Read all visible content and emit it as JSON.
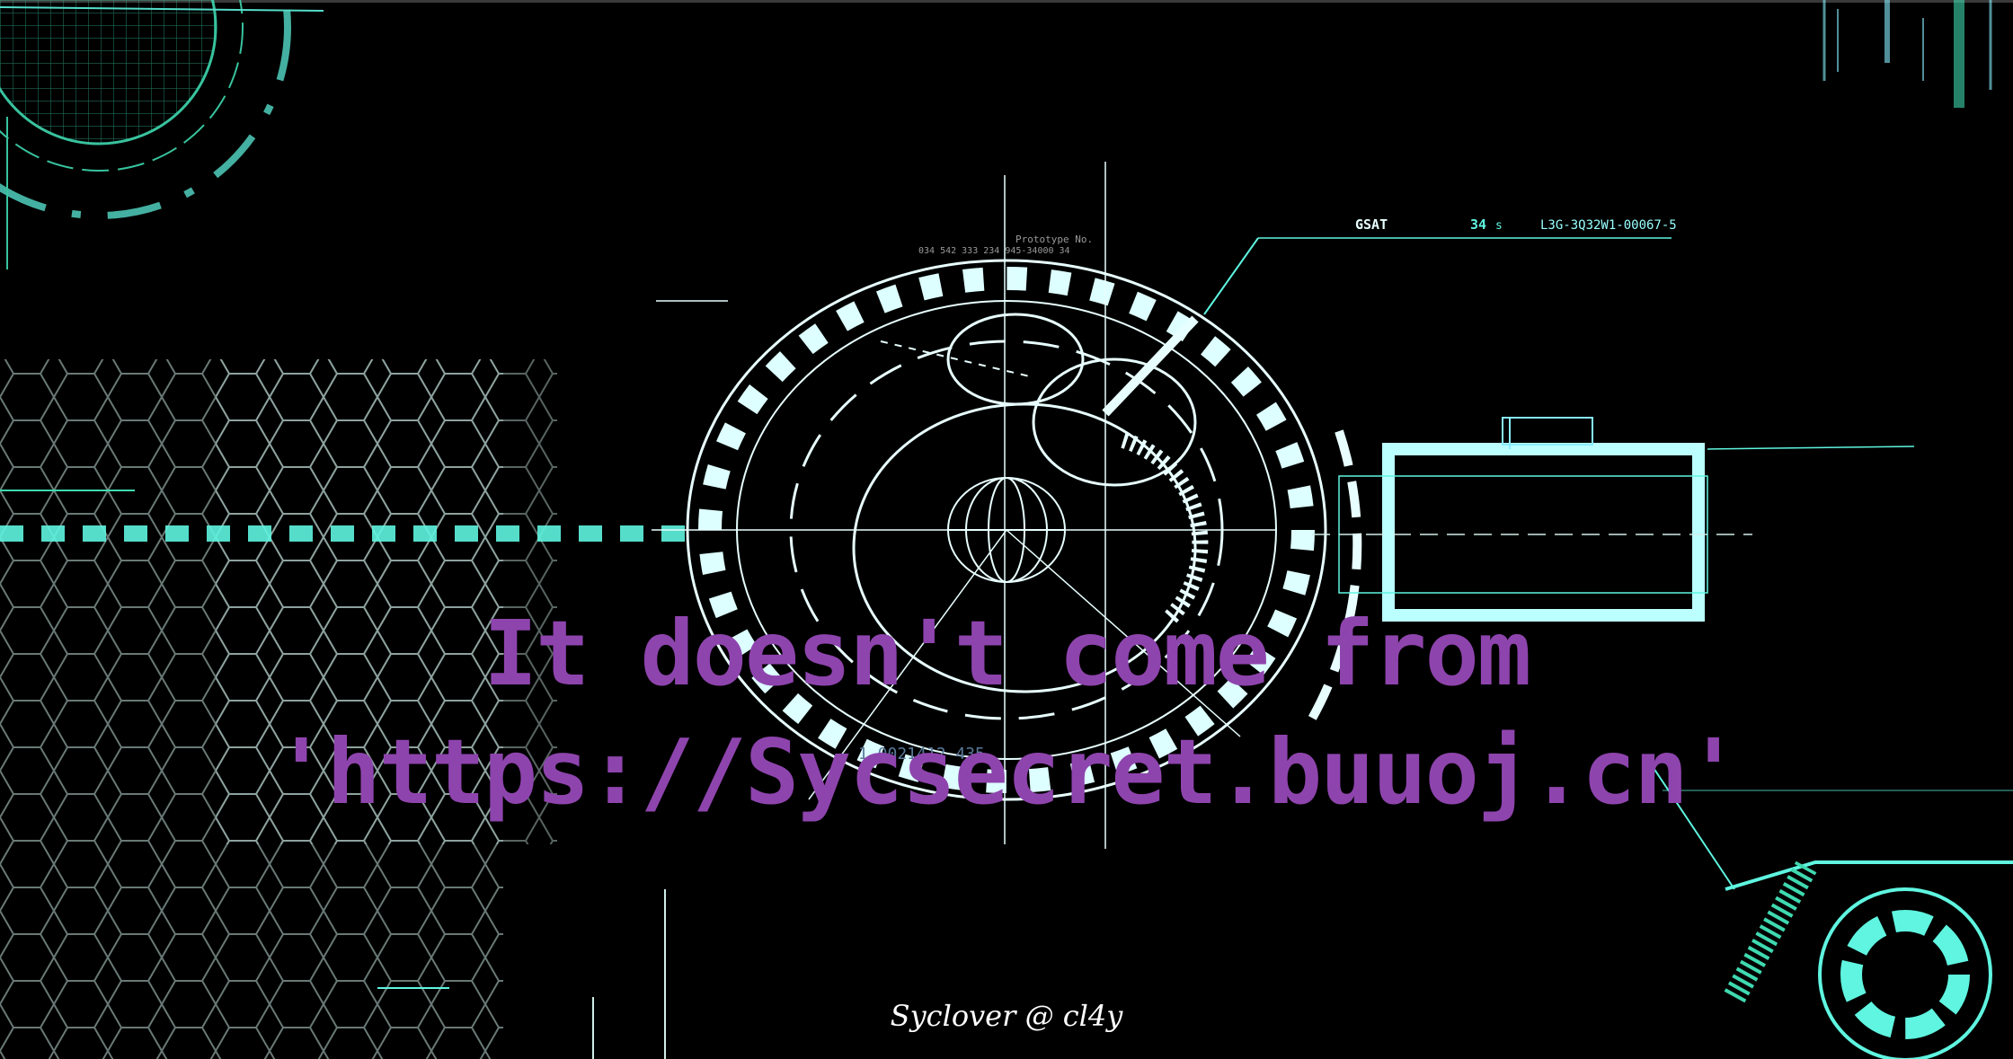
{
  "message": {
    "line1": "It doesn't come from",
    "line2": "'https://Sycsecret.buuoj.cn'"
  },
  "signature": "Syclover @ cl4y",
  "hud_labels": {
    "gsat": "GSAT",
    "gsat_value": "34",
    "gsat_unit": "s",
    "code": "L3G-3Q32W1-00067-5",
    "prototype": "Prototype No.",
    "prototype_digits": "034 542 333 234 945-34000 34",
    "bottom_code": "1.0021412 435"
  },
  "colors": {
    "background": "#000000",
    "message": "#8e44ad",
    "signature": "#ffffff",
    "hud_cyan": "#5ff5e0",
    "hud_white": "#e8ffff"
  }
}
